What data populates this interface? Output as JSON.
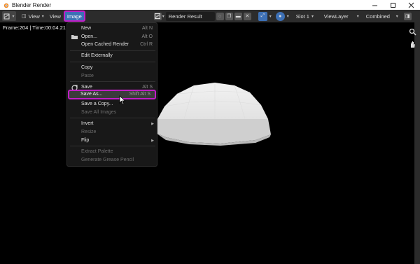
{
  "window": {
    "title": "Blender Render",
    "controls": [
      "minimize-icon",
      "maximize-icon",
      "close-icon"
    ]
  },
  "header": {
    "editor_type_icon": "image-editor-icon",
    "menus": {
      "view1": "View",
      "view2": "View",
      "image": "Image"
    },
    "image_name": "Render Result",
    "slot": "Slot 1",
    "view_layer": "ViewLayer",
    "display": "Combined"
  },
  "viewport": {
    "frame_info": "Frame:204 | Time:00:04.21",
    "background": "#000000"
  },
  "image_menu": {
    "items": [
      {
        "label": "New",
        "shortcut": "Alt N",
        "enabled": true
      },
      {
        "label": "Open...",
        "shortcut": "Alt O",
        "enabled": true,
        "icon": "folder-icon"
      },
      {
        "label": "Open Cached Render",
        "shortcut": "Ctrl R",
        "enabled": true
      },
      {
        "label": "Edit Externally",
        "shortcut": "",
        "enabled": true
      },
      {
        "label": "Copy",
        "shortcut": "",
        "enabled": true
      },
      {
        "label": "Paste",
        "shortcut": "",
        "enabled": false
      },
      {
        "label": "Save",
        "shortcut": "Alt S",
        "enabled": true,
        "icon": "save-icon"
      },
      {
        "label": "Save As...",
        "shortcut": "Shift Alt S",
        "enabled": true,
        "highlighted": true
      },
      {
        "label": "Save a Copy...",
        "shortcut": "",
        "enabled": true
      },
      {
        "label": "Save All Images",
        "shortcut": "",
        "enabled": false
      },
      {
        "label": "Invert",
        "shortcut": "",
        "enabled": true,
        "submenu": true
      },
      {
        "label": "Resize",
        "shortcut": "",
        "enabled": false
      },
      {
        "label": "Flip",
        "shortcut": "",
        "enabled": true,
        "submenu": true
      },
      {
        "label": "Extract Palette",
        "shortcut": "",
        "enabled": false
      },
      {
        "label": "Generate Grease Pencil",
        "shortcut": "",
        "enabled": false
      }
    ]
  },
  "colors": {
    "highlight_border": "#c21ec7",
    "accent_blue": "#3d70b5",
    "header_bg": "#2c2c2c",
    "menu_bg": "#181818"
  }
}
